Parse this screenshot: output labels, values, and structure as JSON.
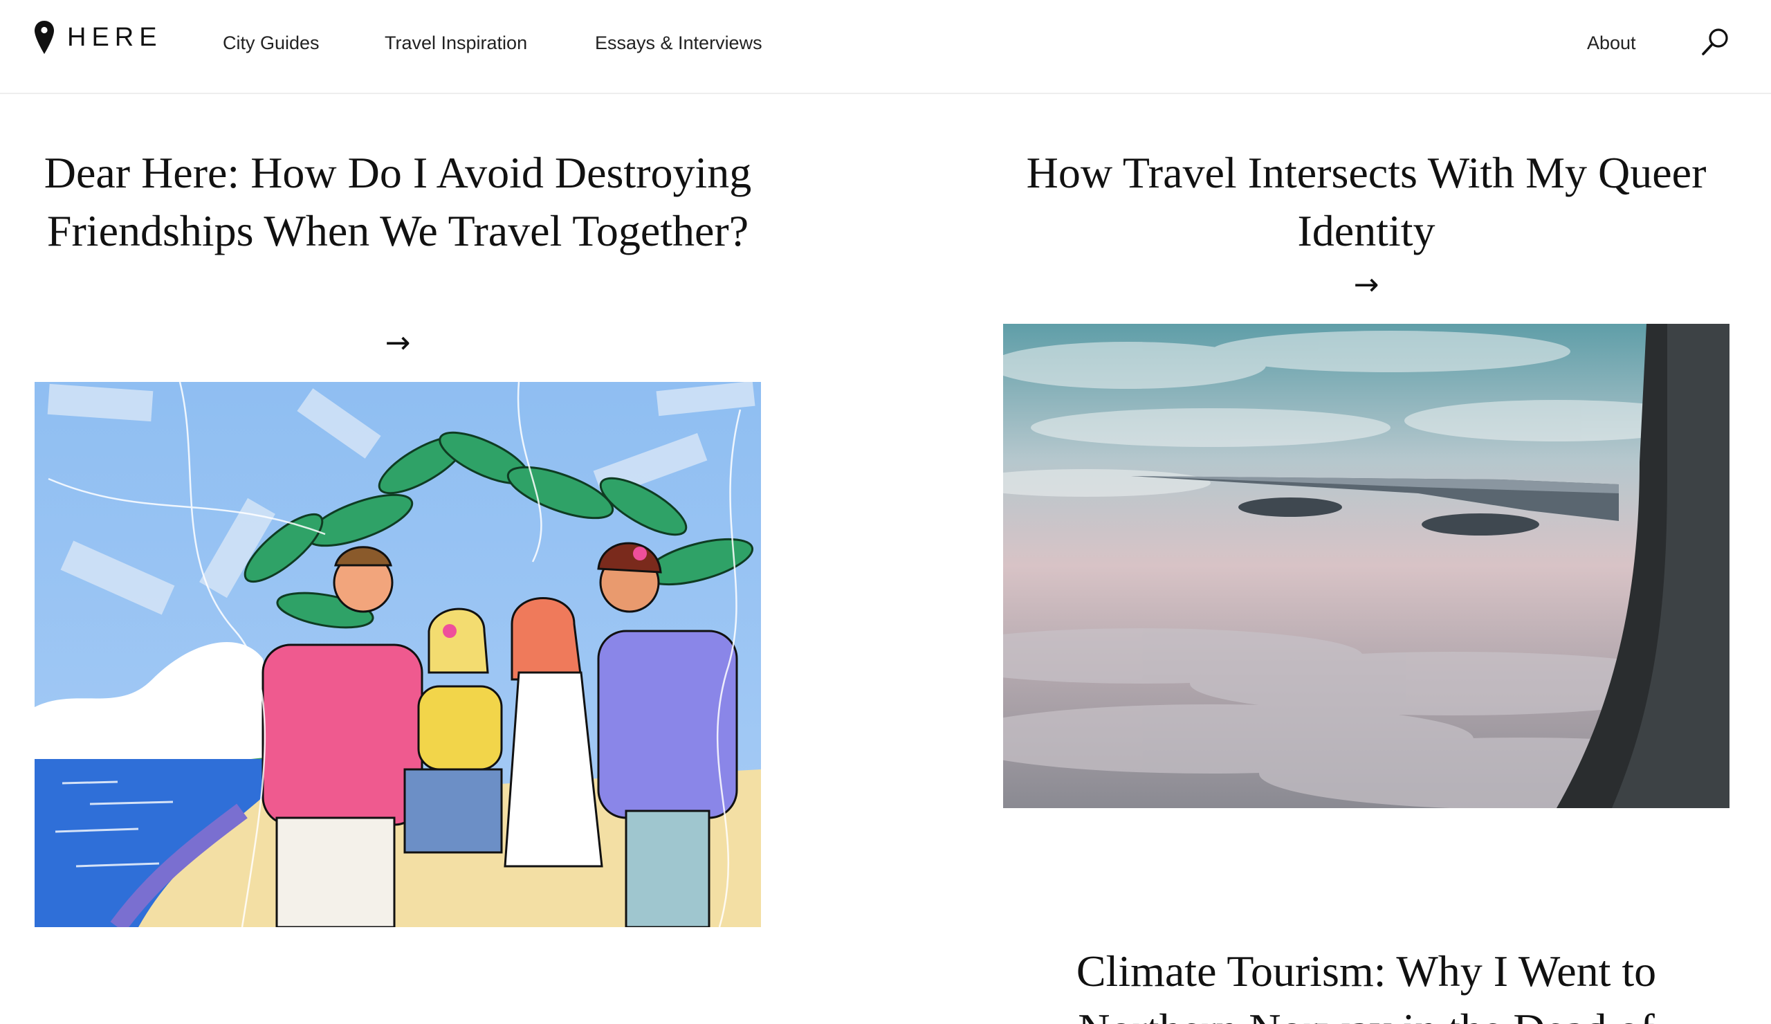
{
  "header": {
    "logo_text": "HERE",
    "nav": [
      "City Guides",
      "Travel Inspiration",
      "Essays & Interviews"
    ],
    "about_label": "About"
  },
  "articles": [
    {
      "title": "Dear Here: How Do I Avoid Destroying Friendships When We Travel Together?",
      "arrow": "→",
      "image": "illustration of four friends holding drinks on a tropical beach"
    },
    {
      "title": "How Travel Intersects With My Queer Identity",
      "arrow": "→",
      "image": "airplane wing above clouds seen through a window"
    },
    {
      "title": "Climate Tourism: Why I Went to Northern Norway in the Dead of"
    }
  ],
  "colors": {
    "text": "#111111",
    "divider": "#eeeeee",
    "background": "#ffffff"
  }
}
